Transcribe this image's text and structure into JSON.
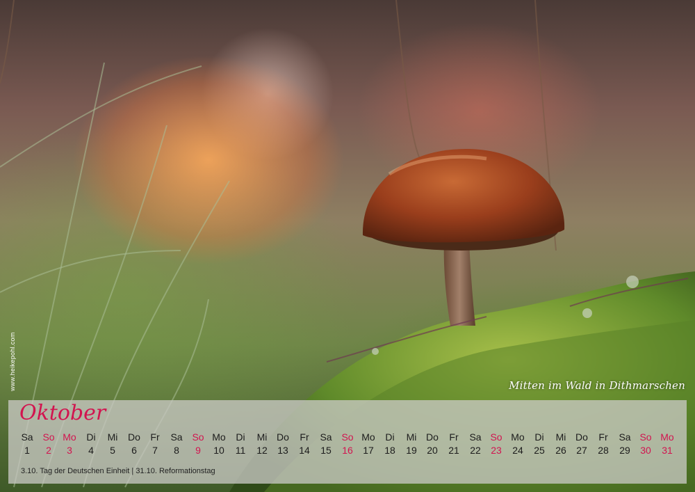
{
  "calendar": {
    "month": "Oktober",
    "caption": "Mitten im Wald in Dithmarschen",
    "website": "www.heikepohl.com",
    "holidays": "3.10. Tag der Deutschen Einheit | 31.10. Reformationstag",
    "sunday_color": "#d2144f",
    "days": [
      {
        "dn": "Sa",
        "num": "1",
        "sun": false
      },
      {
        "dn": "So",
        "num": "2",
        "sun": true
      },
      {
        "dn": "Mo",
        "num": "3",
        "sun": true
      },
      {
        "dn": "Di",
        "num": "4",
        "sun": false
      },
      {
        "dn": "Mi",
        "num": "5",
        "sun": false
      },
      {
        "dn": "Do",
        "num": "6",
        "sun": false
      },
      {
        "dn": "Fr",
        "num": "7",
        "sun": false
      },
      {
        "dn": "Sa",
        "num": "8",
        "sun": false
      },
      {
        "dn": "So",
        "num": "9",
        "sun": true
      },
      {
        "dn": "Mo",
        "num": "10",
        "sun": false
      },
      {
        "dn": "Di",
        "num": "11",
        "sun": false
      },
      {
        "dn": "Mi",
        "num": "12",
        "sun": false
      },
      {
        "dn": "Do",
        "num": "13",
        "sun": false
      },
      {
        "dn": "Fr",
        "num": "14",
        "sun": false
      },
      {
        "dn": "Sa",
        "num": "15",
        "sun": false
      },
      {
        "dn": "So",
        "num": "16",
        "sun": true
      },
      {
        "dn": "Mo",
        "num": "17",
        "sun": false
      },
      {
        "dn": "Di",
        "num": "18",
        "sun": false
      },
      {
        "dn": "Mi",
        "num": "19",
        "sun": false
      },
      {
        "dn": "Do",
        "num": "20",
        "sun": false
      },
      {
        "dn": "Fr",
        "num": "21",
        "sun": false
      },
      {
        "dn": "Sa",
        "num": "22",
        "sun": false
      },
      {
        "dn": "So",
        "num": "23",
        "sun": true
      },
      {
        "dn": "Mo",
        "num": "24",
        "sun": false
      },
      {
        "dn": "Di",
        "num": "25",
        "sun": false
      },
      {
        "dn": "Mi",
        "num": "26",
        "sun": false
      },
      {
        "dn": "Do",
        "num": "27",
        "sun": false
      },
      {
        "dn": "Fr",
        "num": "28",
        "sun": false
      },
      {
        "dn": "Sa",
        "num": "29",
        "sun": false
      },
      {
        "dn": "So",
        "num": "30",
        "sun": true
      },
      {
        "dn": "Mo",
        "num": "31",
        "sun": true
      }
    ]
  }
}
